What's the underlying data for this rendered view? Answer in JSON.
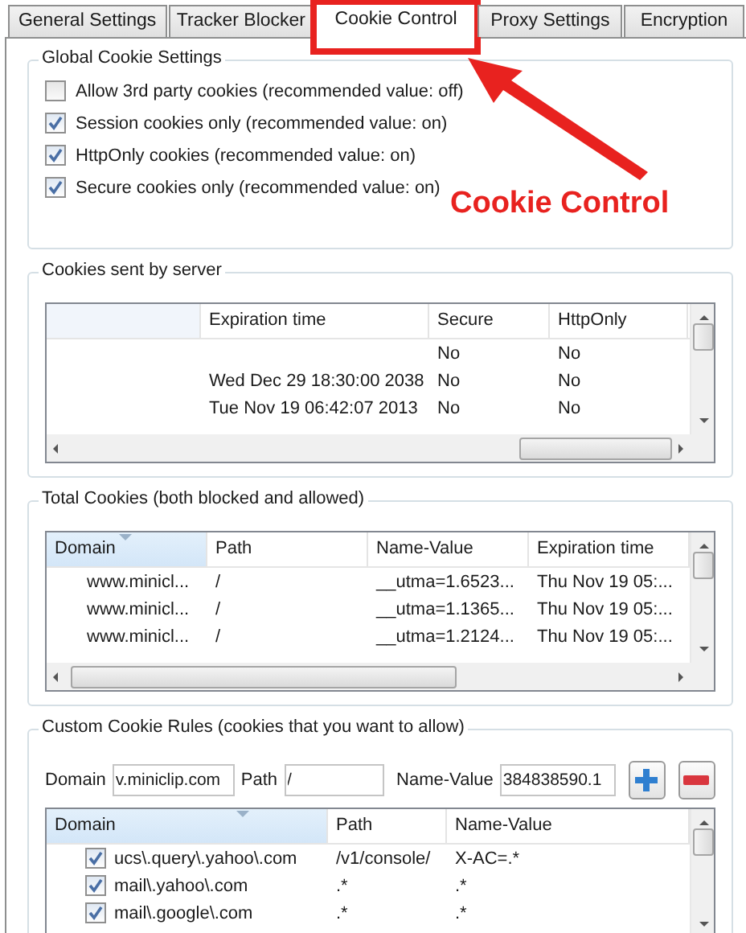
{
  "tabs": [
    {
      "label": "General Settings",
      "selected": false
    },
    {
      "label": "Tracker Blocker",
      "selected": false
    },
    {
      "label": "Cookie Control",
      "selected": true
    },
    {
      "label": "Proxy Settings",
      "selected": false
    },
    {
      "label": "Encryption",
      "selected": false
    }
  ],
  "global_settings": {
    "title": "Global Cookie Settings",
    "options": [
      {
        "label": "Allow 3rd party cookies (recommended value: off)",
        "checked": false
      },
      {
        "label": "Session cookies only (recommended value: on)",
        "checked": true
      },
      {
        "label": "HttpOnly cookies (recommended value: on)",
        "checked": true
      },
      {
        "label": "Secure cookies only (recommended value: on)",
        "checked": true
      }
    ]
  },
  "server_cookies": {
    "title": "Cookies sent by server",
    "columns": [
      {
        "label": "Expiration time",
        "sorted": false
      },
      {
        "label": "Secure",
        "sorted": false
      },
      {
        "label": "HttpOnly",
        "sorted": false
      }
    ],
    "rows": [
      {
        "cells": [
          null,
          "No",
          "No"
        ]
      },
      {
        "cells": [
          "Wed Dec 29 18:30:00 2038",
          "No",
          "No"
        ]
      },
      {
        "cells": [
          "Tue Nov 19 06:42:07 2013",
          "No",
          "No"
        ]
      }
    ]
  },
  "total_cookies": {
    "title": "Total Cookies (both blocked and allowed)",
    "columns": [
      {
        "label": "Domain",
        "sorted": true
      },
      {
        "label": "Path",
        "sorted": false
      },
      {
        "label": "Name-Value",
        "sorted": false
      },
      {
        "label": "Expiration time",
        "sorted": false
      }
    ],
    "rows": [
      {
        "cells": [
          "www.minicl...",
          "/",
          "__utma=1.6523...",
          "Thu Nov 19 05:..."
        ]
      },
      {
        "cells": [
          "www.minicl...",
          "/",
          "__utma=1.1365...",
          "Thu Nov 19 05:..."
        ]
      },
      {
        "cells": [
          "www.minicl...",
          "/",
          "__utma=1.2124...",
          "Thu Nov 19 05:..."
        ]
      }
    ]
  },
  "custom_rules": {
    "title": "Custom Cookie Rules (cookies that you want to allow)",
    "fields": [
      {
        "label": "Domain",
        "value": "v.miniclip.com"
      },
      {
        "label": "Path",
        "value": "/"
      },
      {
        "label": "Name-Value",
        "value": "384838590.1"
      }
    ],
    "columns": [
      {
        "label": "Domain",
        "sorted": true
      },
      {
        "label": "Path",
        "sorted": false
      },
      {
        "label": "Name-Value",
        "sorted": false
      }
    ],
    "rows": [
      {
        "checked": true,
        "cells": [
          "ucs\\.query\\.yahoo\\.com",
          "/v1/console/",
          "X-AC=.*"
        ]
      },
      {
        "checked": true,
        "cells": [
          "mail\\.yahoo\\.com",
          ".*",
          ".*"
        ]
      },
      {
        "checked": true,
        "cells": [
          "mail\\.google\\.com",
          ".*",
          ".*"
        ]
      }
    ]
  },
  "annotation": {
    "label": "Cookie Control"
  }
}
